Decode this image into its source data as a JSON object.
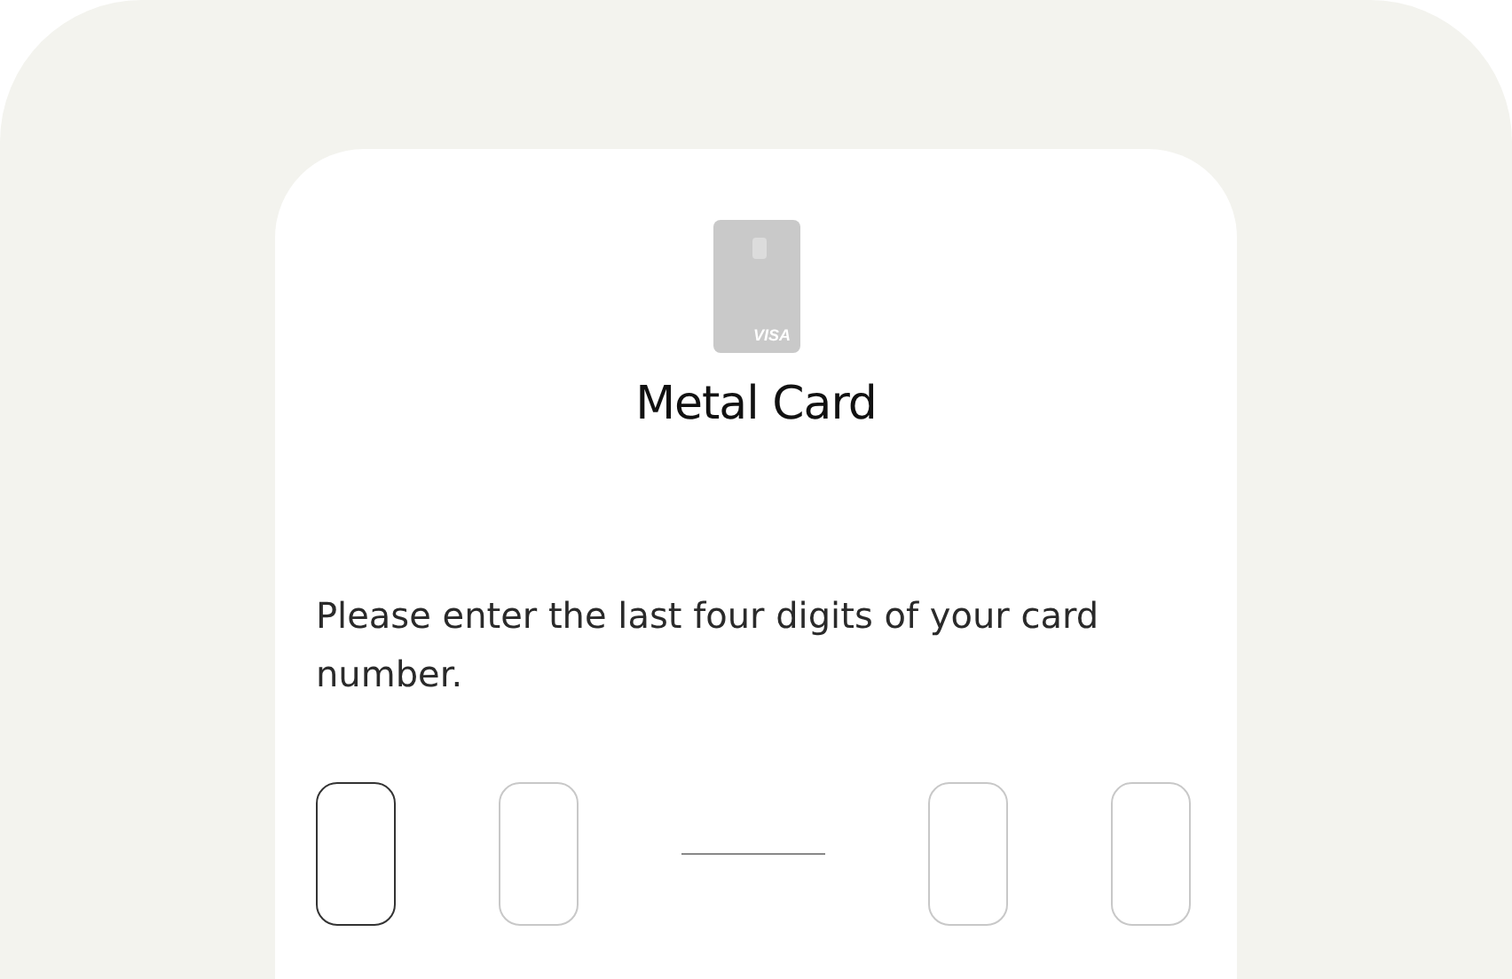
{
  "card": {
    "brand": "VISA",
    "title": "Metal Card"
  },
  "prompt": "Please enter the last four digits of your card number.",
  "digits": [
    {
      "focused": true
    },
    {
      "focused": false
    },
    {
      "focused": false
    },
    {
      "focused": false
    }
  ]
}
